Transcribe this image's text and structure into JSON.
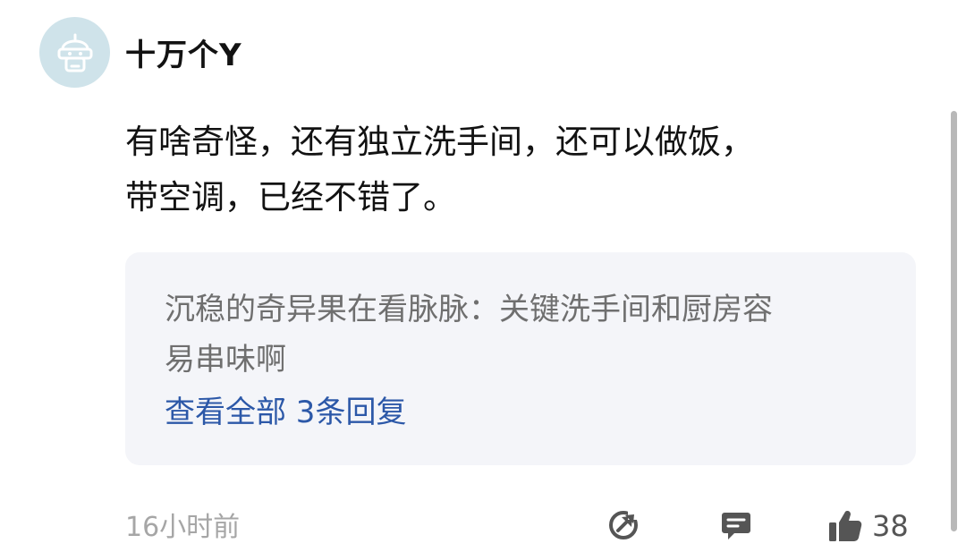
{
  "comment": {
    "username": "十万个Y",
    "avatar_icon": "robot-helmet-icon",
    "content_lines": [
      "有啥奇怪，还有独立洗手间，还可以做饭，",
      "带空调，已经不错了。"
    ],
    "reply": {
      "author_prefix": "沉稳的奇异果在看脉脉：",
      "text_line1": "关键洗手间和厨房容",
      "text_line2": "易串味啊",
      "view_all_label": "查看全部 3条回复"
    },
    "timestamp": "16小时前",
    "actions": {
      "share_icon": "share-icon",
      "comment_icon": "comment-icon",
      "like_icon": "thumbs-up-icon",
      "like_count": "38"
    }
  },
  "colors": {
    "avatar_bg": "#cfe3ea",
    "reply_bg": "#f4f5f9",
    "link": "#2c58a8",
    "muted": "#a6a6a6"
  }
}
